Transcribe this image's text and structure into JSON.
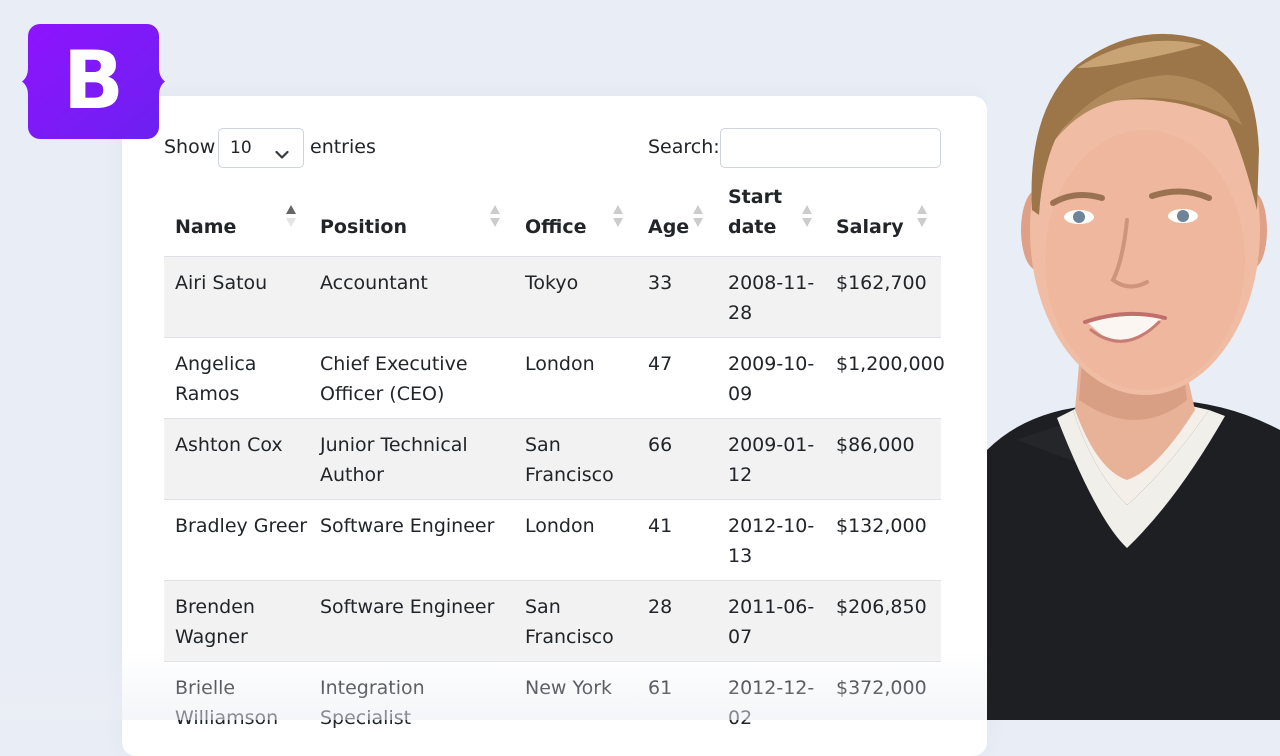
{
  "brand": {
    "logo_letter": "B",
    "logo_color": "#7a2ff5"
  },
  "table_controls": {
    "show_label": "Show",
    "page_length": "10",
    "entries_label": "entries",
    "search_label": "Search:",
    "search_value": ""
  },
  "columns": [
    "Name",
    "Position",
    "Office",
    "Age",
    "Start\ndate",
    "Salary"
  ],
  "sorted_column": "Name",
  "rows": [
    [
      "Airi Satou",
      "Accountant",
      "Tokyo",
      "33",
      "2008-11-\n28",
      "$162,700"
    ],
    [
      "Angelica\nRamos",
      "Chief Executive\nOfficer (CEO)",
      "London",
      "47",
      "2009-10-\n09",
      "$1,200,000"
    ],
    [
      "Ashton Cox",
      "Junior Technical\nAuthor",
      "San\nFrancisco",
      "66",
      "2009-01-\n12",
      "$86,000"
    ],
    [
      "Bradley Greer",
      "Software Engineer",
      "London",
      "41",
      "2012-10-\n13",
      "$132,000"
    ],
    [
      "Brenden\nWagner",
      "Software Engineer",
      "San\nFrancisco",
      "28",
      "2011-06-\n07",
      "$206,850"
    ],
    [
      "Brielle\nWilliamson",
      "Integration\nSpecialist",
      "New York",
      "61",
      "2012-12-\n02",
      "$372,000"
    ]
  ]
}
